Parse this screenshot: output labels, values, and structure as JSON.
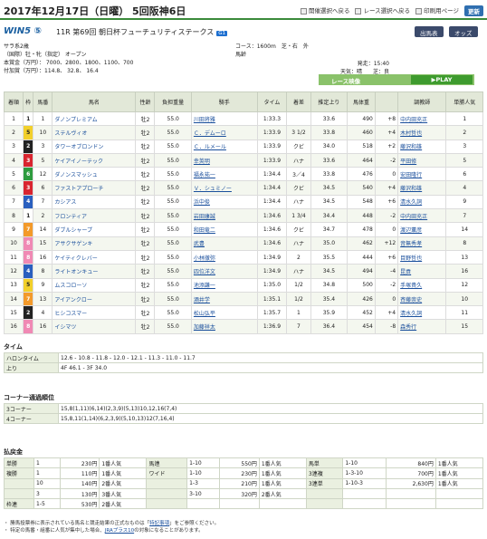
{
  "header": {
    "date": "2017年12月17日（日曜） 5回阪神6日",
    "links": [
      "開催選択へ戻る",
      "レース選択へ戻る",
      "印刷用ページ"
    ],
    "update": "更新"
  },
  "race": {
    "logo": "WIN5 ⑤",
    "title": "11R 第69回 朝日杯フューチュリティステークス",
    "grade": "G1",
    "btn_entries": "出馬表",
    "btn_odds": "オッズ",
    "class": "サラ系2歳",
    "condition": "（国際）牡・牝（指定） オープン",
    "prize": "本賞金（万円）： 7000、2800、1800、1100、700",
    "addprize": "付加賞（万円）：114.8、 32.8、 16.4",
    "course": "コース：1600m　芝・右　外",
    "weight": "馬齢",
    "start": "発走：15:40",
    "weather": "天気：晴　　芝：良",
    "replay_label": "レース映像",
    "replay_play": "▶PLAY"
  },
  "columns": [
    "着順",
    "枠",
    "馬番",
    "馬名",
    "性齢",
    "負担重量",
    "騎手",
    "タイム",
    "着差",
    "推定上り",
    "馬体重",
    "",
    "調教師",
    "単勝人気"
  ],
  "results": [
    [
      "1",
      "1",
      "1",
      "ダノンプレミアム",
      "牡2",
      "55.0",
      "川田将雅",
      "1:33.3",
      "",
      "33.6",
      "490",
      "+8",
      "中内田充正",
      "1"
    ],
    [
      "2",
      "5",
      "10",
      "ステルヴィオ",
      "牡2",
      "55.0",
      "Ｃ．デムーロ",
      "1:33.9",
      "3 1/2",
      "33.8",
      "460",
      "+4",
      "木村哲也",
      "2"
    ],
    [
      "3",
      "2",
      "3",
      "タワーオブロンドン",
      "牡2",
      "55.0",
      "Ｃ．ルメール",
      "1:33.9",
      "クビ",
      "34.0",
      "518",
      "+2",
      "藤沢和雄",
      "3"
    ],
    [
      "4",
      "3",
      "5",
      "ケイアイノーテック",
      "牡2",
      "55.0",
      "幸英明",
      "1:33.9",
      "ハナ",
      "33.6",
      "464",
      "-2",
      "平田修",
      "5"
    ],
    [
      "5",
      "6",
      "12",
      "ダノンスマッシュ",
      "牡2",
      "55.0",
      "福永祐一",
      "1:34.4",
      "3／4",
      "33.8",
      "476",
      "0",
      "安田隆行",
      "6"
    ],
    [
      "6",
      "3",
      "6",
      "ファストアプローチ",
      "牡2",
      "55.0",
      "Ｖ．シュミノー",
      "1:34.4",
      "クビ",
      "34.5",
      "540",
      "+4",
      "藤沢和雄",
      "4"
    ],
    [
      "7",
      "4",
      "7",
      "カシアス",
      "牡2",
      "55.0",
      "浜中俊",
      "1:34.4",
      "ハナ",
      "34.5",
      "548",
      "+6",
      "清水久詞",
      "9"
    ],
    [
      "8",
      "1",
      "2",
      "フロンティア",
      "牡2",
      "55.0",
      "岩田康誠",
      "1:34.6",
      "1 3/4",
      "34.4",
      "448",
      "-2",
      "中内田充正",
      "7"
    ],
    [
      "9",
      "7",
      "14",
      "ダブルシャープ",
      "牡2",
      "55.0",
      "和田竜二",
      "1:34.6",
      "クビ",
      "34.7",
      "478",
      "0",
      "渡辺薫彦",
      "14"
    ],
    [
      "10",
      "8",
      "15",
      "アサクサゲンキ",
      "牡2",
      "55.0",
      "武豊",
      "1:34.6",
      "ハナ",
      "35.0",
      "462",
      "+12",
      "音無秀孝",
      "8"
    ],
    [
      "11",
      "8",
      "16",
      "ケイティクレバー",
      "牡2",
      "55.0",
      "小林徹弥",
      "1:34.9",
      "2",
      "35.5",
      "444",
      "+6",
      "目野哲也",
      "13"
    ],
    [
      "12",
      "4",
      "8",
      "ライトオンキュー",
      "牡2",
      "55.0",
      "四位洋文",
      "1:34.9",
      "ハナ",
      "34.5",
      "494",
      "-4",
      "昆貢",
      "16"
    ],
    [
      "13",
      "5",
      "9",
      "ムスコローソ",
      "牡2",
      "55.0",
      "池添謙一",
      "1:35.0",
      "1/2",
      "34.8",
      "500",
      "-2",
      "手塚貴久",
      "12"
    ],
    [
      "14",
      "7",
      "13",
      "アイアンクロー",
      "牡2",
      "55.0",
      "酒井学",
      "1:35.1",
      "1/2",
      "35.4",
      "426",
      "0",
      "斉藤崇史",
      "10"
    ],
    [
      "15",
      "2",
      "4",
      "ヒシコスマー",
      "牡2",
      "55.0",
      "松山弘平",
      "1:35.7",
      "1",
      "35.9",
      "452",
      "+4",
      "清水久詞",
      "11"
    ],
    [
      "16",
      "8",
      "16",
      "イシマツ",
      "牡2",
      "55.0",
      "加藤祥太",
      "1:36.9",
      "7",
      "36.4",
      "454",
      "-8",
      "森秀行",
      "15"
    ]
  ],
  "waku_colors": {
    "1": "#ffffff",
    "2": "#222222",
    "3": "#d9252f",
    "4": "#2a5fbf",
    "5": "#f2d02a",
    "6": "#2e9b3f",
    "7": "#f39a2a",
    "8": "#f089b4"
  },
  "lap": {
    "title": "タイム",
    "furlong_label": "ハロンタイム",
    "furlong": "12.6 - 10.8 - 11.8 - 12.0 - 12.1 - 11.3 - 11.0 - 11.7",
    "up_label": "上り",
    "up": "4F 46.1 - 3F 34.0"
  },
  "corner": {
    "title": "コーナー通過順位",
    "c3_label": "3コーナー",
    "c3": "15,8(1,11)(6,14)(2,3,9)(5,13)10,12,16(7,4)",
    "c4_label": "4コーナー",
    "c4": "15,8,11(1,14)(6,2,3,9)(5,10,13)12(7,16,4)"
  },
  "payout": {
    "title": "払戻金",
    "win_label": "単勝",
    "win": [
      [
        "1",
        "230円",
        "1番人気"
      ]
    ],
    "place_label": "複勝",
    "place": [
      [
        "1",
        "110円",
        "1番人気"
      ],
      [
        "10",
        "140円",
        "2番人気"
      ],
      [
        "3",
        "130円",
        "3番人気"
      ]
    ],
    "bracket_label": "枠連",
    "bracket": [
      [
        "1-5",
        "530円",
        "2番人気"
      ]
    ],
    "quinella_label": "馬連",
    "quinella": [
      [
        "1-10",
        "550円",
        "1番人気"
      ]
    ],
    "wide_label": "ワイド",
    "wide": [
      [
        "1-10",
        "230円",
        "1番人気"
      ],
      [
        "1-3",
        "210円",
        "1番人気"
      ],
      [
        "3-10",
        "320円",
        "2番人気"
      ]
    ],
    "exacta_label": "馬単",
    "exacta": [
      [
        "1-10",
        "840円",
        "1番人気"
      ]
    ],
    "trio_label": "3連複",
    "trio": [
      [
        "1-3-10",
        "700円",
        "1番人気"
      ]
    ],
    "trifecta_label": "3連単",
    "trifecta": [
      [
        "1-10-3",
        "2,630円",
        "1番人気"
      ]
    ]
  },
  "notes": {
    "n1a": "・ 勝馬投票券に表示されている馬名と競走結果の正式なものは「",
    "n1link": "特記事項",
    "n1b": "」をご参照ください。",
    "n2a": "・ 特定の馬番・組番に人気が集中した場合、",
    "n2link": "JRAプラス10",
    "n2b": "の対象になることがあります。"
  }
}
